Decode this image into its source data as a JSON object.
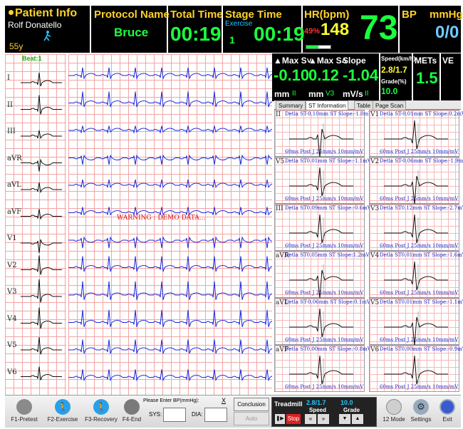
{
  "header": {
    "patient_info_label": "Patient Info",
    "patient_name": "Rolf  Donatello",
    "patient_age": "55y",
    "protocol_label": "Protocol Name",
    "protocol_value": "Bruce",
    "total_time_label": "Total Time",
    "total_time_value": "00:19",
    "stage_time_label": "Stage Time",
    "stage_name": "Exercise",
    "stage_number": "1",
    "stage_time_value": "00:19",
    "hr_label": "HR(bpm)",
    "hr_percent": "49%",
    "hr_target": "148",
    "hr_value": "73",
    "hr_progress": 0.49,
    "bp_label": "BP",
    "bp_unit": "mmHg",
    "bp_value": "0/0"
  },
  "ecg": {
    "beat_label": "Beat:1",
    "leads": [
      "I",
      "II",
      "III",
      "aVR",
      "aVL",
      "aVF",
      "V1",
      "V2",
      "V3",
      "V4",
      "V5",
      "V6"
    ],
    "warning": "WARNING : DEMO DATA..."
  },
  "st_summary": {
    "max_st_label": "Max S",
    "max_st_value": "-0.10",
    "max_st_unit": "mm",
    "max_st_lead": "II",
    "max_st2_label": "Max S",
    "max_st2_value": "0.12",
    "max_st2_unit": "mm",
    "max_st2_lead": "V3",
    "slope_label": "Slope",
    "slope_value": "-1.04",
    "slope_unit": "mV/s",
    "slope_lead": "II",
    "speed_label": "Speed(km/h)",
    "speed_value": "2.8/1.7",
    "grade_label": "Grade(%)",
    "grade_value": "10.0",
    "mets_label": "METs",
    "mets_value": "1.5",
    "ve_label": "VE"
  },
  "tabs": [
    "Summary",
    "ST Information",
    "Table",
    "Page Scan"
  ],
  "active_tab": "ST Information",
  "st_cells": [
    {
      "lead": "II",
      "top": "Detla ST-0.10mm ST Slope:-1.0mV/s",
      "bottom": "60ms Post J     25mm/s 10mm/mV"
    },
    {
      "lead": "V1",
      "top": "Detla ST-0.01mm ST Slope:0.2mV/s",
      "bottom": "60ms Post J     25mm/s 10mm/mV"
    },
    {
      "lead": "V5",
      "top": "Detla ST0.01mm ST Slope:-1.1mV/s",
      "bottom": "60ms Post J     25mm/s 10mm/mV"
    },
    {
      "lead": "V2",
      "top": "Detla ST-0.06mm ST Slope:-1.9mV/s",
      "bottom": "60ms Post J     25mm/s 10mm/mV"
    },
    {
      "lead": "III",
      "top": "Detla ST0.09mm ST Slope:-0.6mV/s",
      "bottom": "60ms Post J     25mm/s 10mm/mV"
    },
    {
      "lead": "V3",
      "top": "Detla ST0.12mm ST Slope:-2.7mV/s",
      "bottom": "60ms Post J     25mm/s 10mm/mV"
    },
    {
      "lead": "aVR",
      "top": "Detla ST0.05mm ST Slope:1.2mV/s",
      "bottom": "60ms Post J     25mm/s 10mm/mV"
    },
    {
      "lead": "V4",
      "top": "Detla ST0.01mm ST Slope:-1.6mV/s",
      "bottom": "60ms Post J     25mm/s 10mm/mV"
    },
    {
      "lead": "aVL",
      "top": "Detla ST-0.06mm ST Slope:0.1mV/s",
      "bottom": "60ms Post J     25mm/s 10mm/mV"
    },
    {
      "lead": "V5",
      "top": "Detla ST0.01mm ST Slope:-1.1mV/s",
      "bottom": "60ms Post J     25mm/s 10mm/mV"
    },
    {
      "lead": "aVF",
      "top": "Detla ST0.00mm ST Slope:-0.8mV/s",
      "bottom": "60ms Post J     25mm/s 10mm/mV"
    },
    {
      "lead": "V6",
      "top": "Detla ST0.00mm ST Slope:-0.9mV/s",
      "bottom": "60ms Post J     25mm/s 10mm/mV"
    }
  ],
  "footer": {
    "pretest": "F1-Pretest",
    "exercise": "F2-Exercise",
    "recovery": "F3-Recovery",
    "end": "F4-End",
    "bp_prompt": "Please Enter BP(mmHg):",
    "bp_close": "X",
    "sys_label": "SYS:",
    "dia_label": "DIA:",
    "conclusion": "Conclusion",
    "auto": "Auto",
    "treadmill_label": "Treadmill",
    "treadmill_speed": "2.8/1.7",
    "treadmill_grade": "10.0",
    "speed_label": "Speed",
    "grade_label": "Grade",
    "stop": "Stop",
    "mode12": "12 Mode",
    "settings": "Settings",
    "exit": "Exit"
  },
  "colors": {
    "header_bg": "#000000",
    "label_yellow": "#ffd12a",
    "value_green": "#1bff3f",
    "bp_blue": "#6ecbff",
    "hr_red": "#ff3030",
    "trace_blue": "#1a2ae0",
    "warning_red": "#e01010"
  }
}
